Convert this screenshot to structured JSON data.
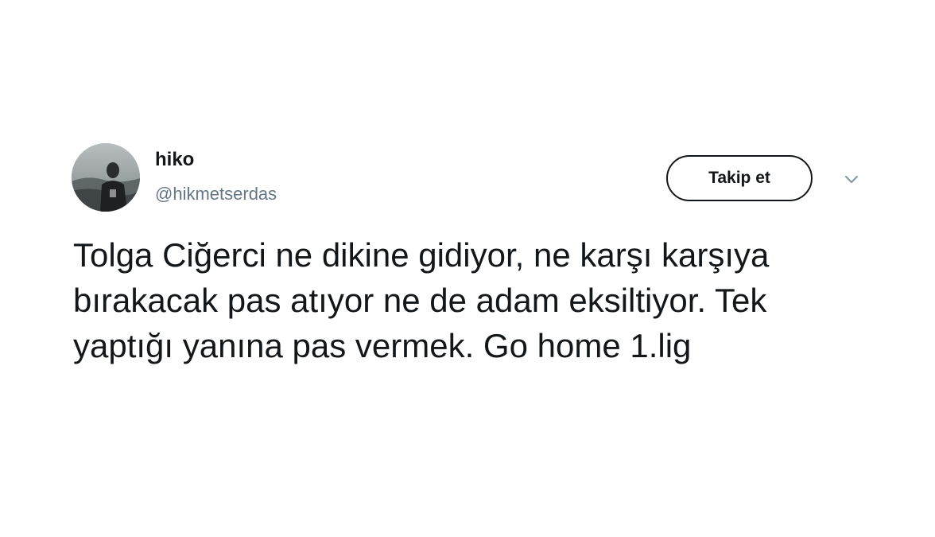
{
  "user": {
    "display_name": "hiko",
    "handle": "@hikmetserdas",
    "avatar_icon": "profile-photo"
  },
  "actions": {
    "follow_label": "Takip et",
    "more_icon": "chevron-down-icon"
  },
  "tweet": {
    "text": "Tolga Ciğerci ne dikine gidiyor, ne karşı karşıya bırakacak pas atıyor ne de adam eksiltiyor. Tek yaptığı yanına pas vermek. Go home 1.lig"
  },
  "colors": {
    "text_primary": "#14171a",
    "text_secondary": "#657786",
    "background": "#ffffff"
  }
}
